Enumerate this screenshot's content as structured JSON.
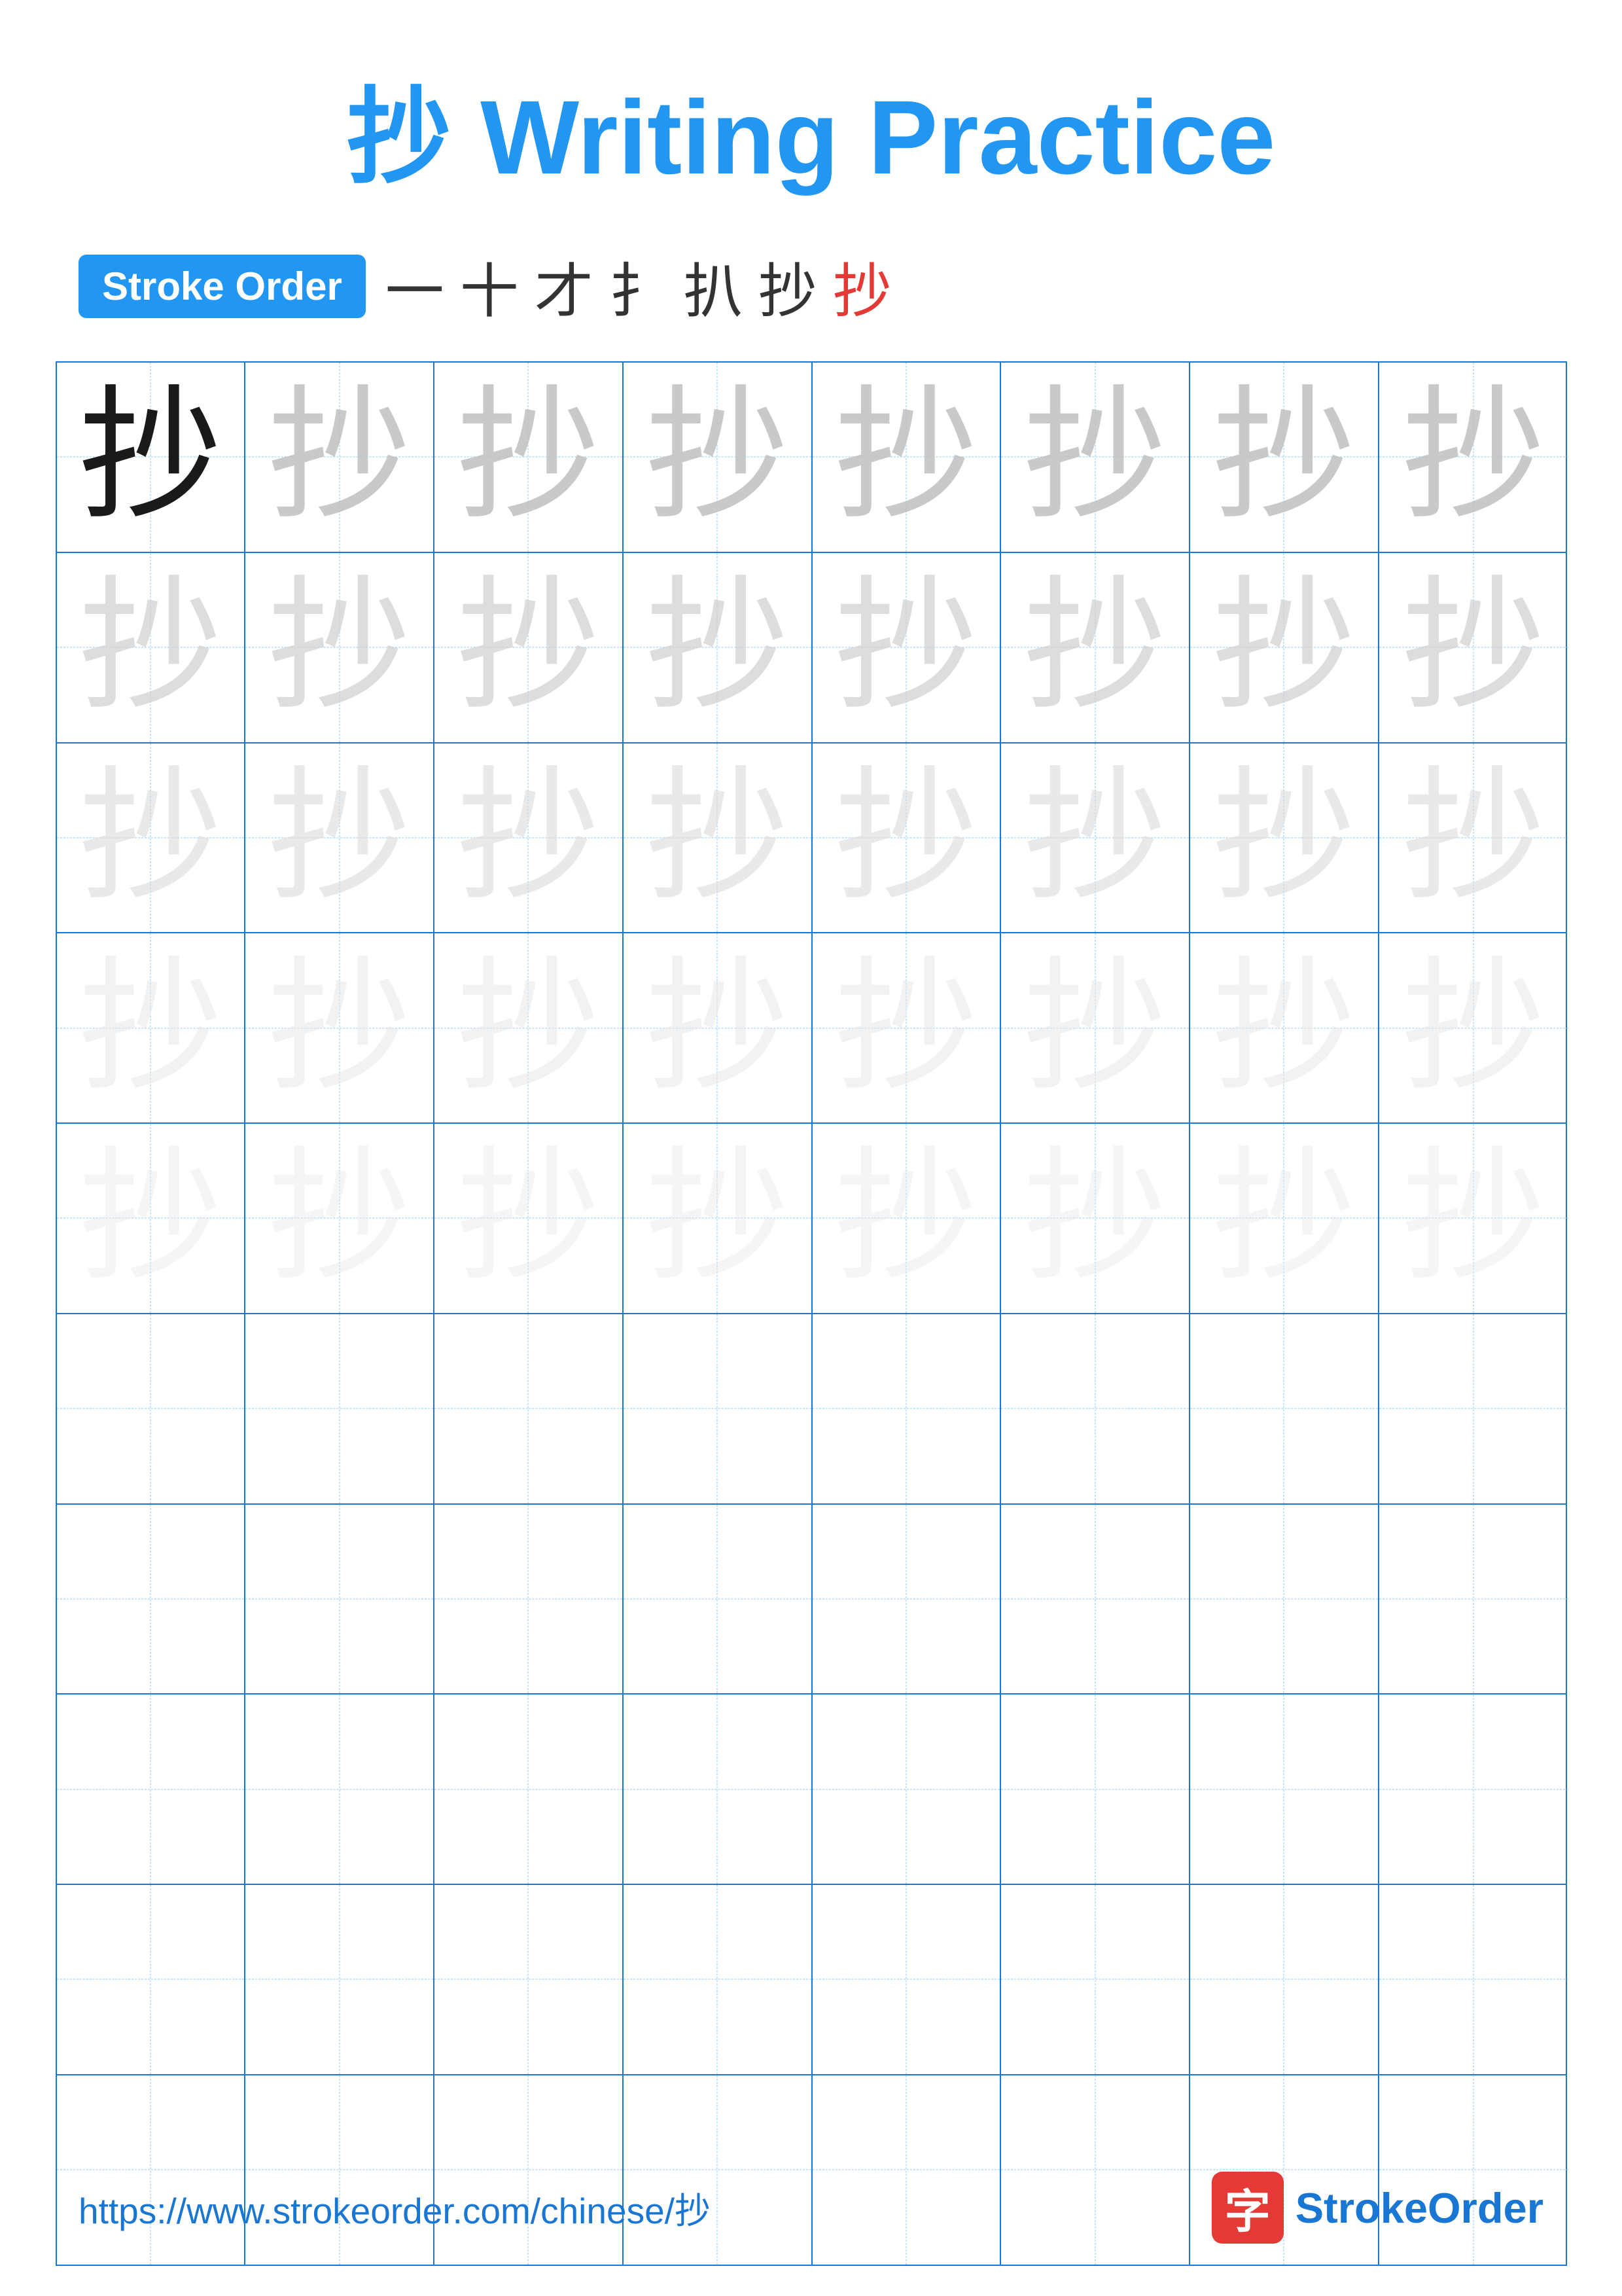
{
  "title": {
    "char": "抄",
    "text": "Writing Practice",
    "full": "抄 Writing Practice"
  },
  "strokeOrder": {
    "badge": "Stroke Order",
    "chars": [
      "一",
      "十",
      "才",
      "扌",
      "扒",
      "抄",
      "抄"
    ]
  },
  "grid": {
    "rows": 10,
    "cols": 8,
    "char": "抄",
    "charRows": 5
  },
  "footer": {
    "url": "https://www.strokeorder.com/chinese/抄",
    "logoChar": "字",
    "logoText": "StrokeOrder"
  }
}
